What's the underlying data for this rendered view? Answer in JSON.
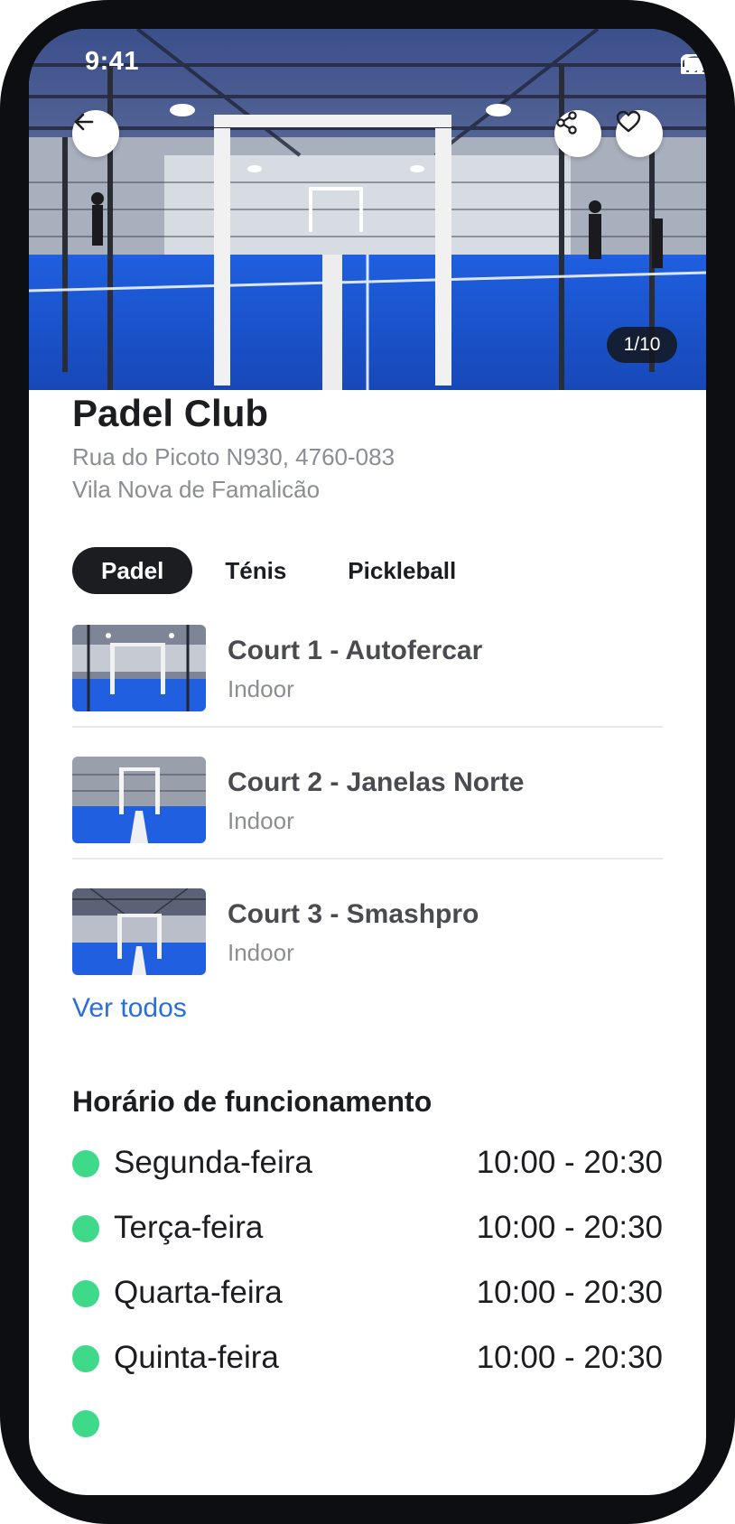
{
  "status_bar": {
    "time": "9:41"
  },
  "hero": {
    "photo_counter": "1/10"
  },
  "venue": {
    "name": "Padel Club",
    "address_line1": "Rua do Picoto N930, 4760-083",
    "address_line2": "Vila Nova de Famalicão"
  },
  "tabs": [
    {
      "label": "Padel",
      "active": true
    },
    {
      "label": "Ténis",
      "active": false
    },
    {
      "label": "Pickleball",
      "active": false
    }
  ],
  "courts": [
    {
      "name": "Court 1 - Autofercar",
      "type": "Indoor"
    },
    {
      "name": "Court 2 - Janelas Norte",
      "type": "Indoor"
    },
    {
      "name": "Court 3 - Smashpro",
      "type": "Indoor"
    }
  ],
  "see_all_label": "Ver todos",
  "hours": {
    "title": "Horário de funcionamento",
    "rows": [
      {
        "day": "Segunda-feira",
        "time": "10:00 - 20:30"
      },
      {
        "day": "Terça-feira",
        "time": "10:00 - 20:30"
      },
      {
        "day": "Quarta-feira",
        "time": "10:00 - 20:30"
      },
      {
        "day": "Quinta-feira",
        "time": "10:00 - 20:30"
      }
    ]
  },
  "colors": {
    "accent_link": "#2a6fd6",
    "open_dot": "#3fd98a",
    "tab_active_bg": "#1c1d21",
    "court_blue": "#1f5fe0"
  },
  "icons": {
    "back": "arrow-left-icon",
    "share": "share-icon",
    "favorite": "heart-icon"
  }
}
